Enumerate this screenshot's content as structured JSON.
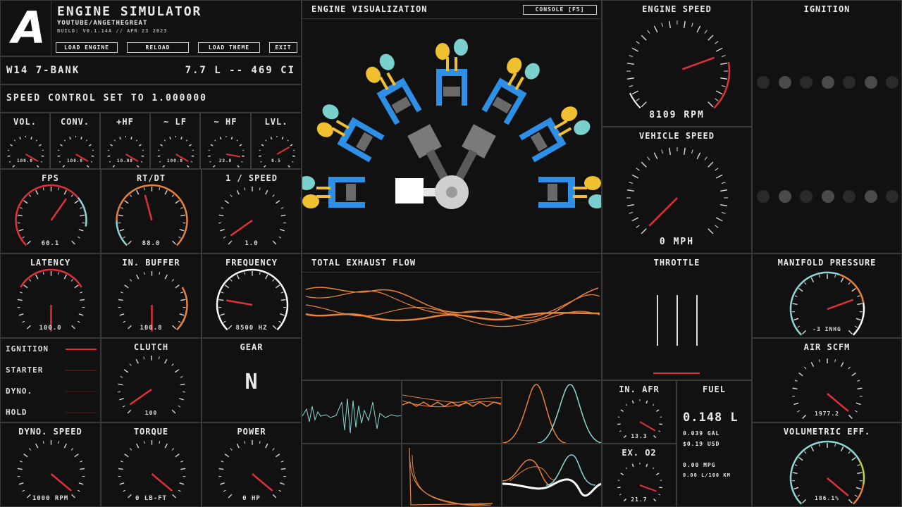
{
  "header": {
    "logo_letter": "A",
    "title": "ENGINE SIMULATOR",
    "channel": "YOUTUBE/ANGETHEGREAT",
    "build": "BUILD: V0.1.14A // APR 23 2023",
    "buttons": [
      "LOAD ENGINE",
      "RELOAD",
      "LOAD THEME",
      "EXIT"
    ]
  },
  "engine_info": {
    "name": "W14 7-BANK",
    "displacement": "7.7 L -- 469 CI"
  },
  "speed_control": "SPEED CONTROL SET TO 1.000000",
  "audio_gauges": [
    {
      "label": "VOL.",
      "value": "100.0"
    },
    {
      "label": "CONV.",
      "value": "100.0"
    },
    {
      "label": "+HF",
      "value": "10.00"
    },
    {
      "label": "~ LF",
      "value": "100.0"
    },
    {
      "label": "~ HF",
      "value": "23.0"
    },
    {
      "label": "LVL.",
      "value": "0.5"
    }
  ],
  "perf_gauges": [
    {
      "label": "FPS",
      "value": "60.1"
    },
    {
      "label": "RT/DT",
      "value": "88.0"
    },
    {
      "label": "1 / SPEED",
      "value": "1.0"
    },
    {
      "label": "LATENCY",
      "value": "100.0"
    },
    {
      "label": "IN. BUFFER",
      "value": "100.8"
    },
    {
      "label": "FREQUENCY",
      "value": "8500 HZ"
    }
  ],
  "switches": [
    {
      "label": "IGNITION",
      "color": "#e03030"
    },
    {
      "label": "STARTER",
      "color": "#4a1818"
    },
    {
      "label": "DYNO.",
      "color": "#3a1414"
    },
    {
      "label": "HOLD",
      "color": "#3a1414"
    }
  ],
  "clutch": {
    "label": "CLUTCH",
    "value": "100"
  },
  "gear": {
    "label": "GEAR",
    "value": "N"
  },
  "bottom_gauges": [
    {
      "label": "DYNO. SPEED",
      "value": "1000 RPM"
    },
    {
      "label": "TORQUE",
      "value": "0 LB-FT"
    },
    {
      "label": "POWER",
      "value": "0 HP"
    }
  ],
  "visualization": {
    "title": "ENGINE VISUALIZATION",
    "console_button": "CONSOLE [F5]"
  },
  "exhaust": {
    "title": "TOTAL EXHAUST FLOW"
  },
  "engine_speed": {
    "label": "ENGINE SPEED",
    "value": "8109 RPM",
    "level": 0.62
  },
  "vehicle_speed": {
    "label": "VEHICLE SPEED",
    "value": "0 MPH",
    "level": 0.0
  },
  "throttle": {
    "label": "THROTTLE"
  },
  "afr": {
    "label": "IN. AFR",
    "value": "13.3"
  },
  "o2": {
    "label": "EX. O2",
    "value": "21.7"
  },
  "fuel": {
    "label": "FUEL",
    "liters": "0.148 L",
    "gal": "0.039 GAL",
    "usd": "$0.19 USD",
    "mpg": "0.00 MPG",
    "lkm": "0.00 L/100 KM"
  },
  "ignition_panel": {
    "label": "IGNITION"
  },
  "manifold": {
    "label": "MANIFOLD PRESSURE",
    "value": "-3 INHG"
  },
  "air_scfm": {
    "label": "AIR SCFM",
    "value": "1977.2"
  },
  "vol_eff": {
    "label": "VOLUMETRIC EFF.",
    "value": "186.1%"
  },
  "colors": {
    "needle": "#e0303a",
    "orange": "#e8823a",
    "cyan": "#8fd6d6",
    "blue": "#2d8fe6",
    "yellow": "#f0c030",
    "teal": "#7ad0cc"
  }
}
